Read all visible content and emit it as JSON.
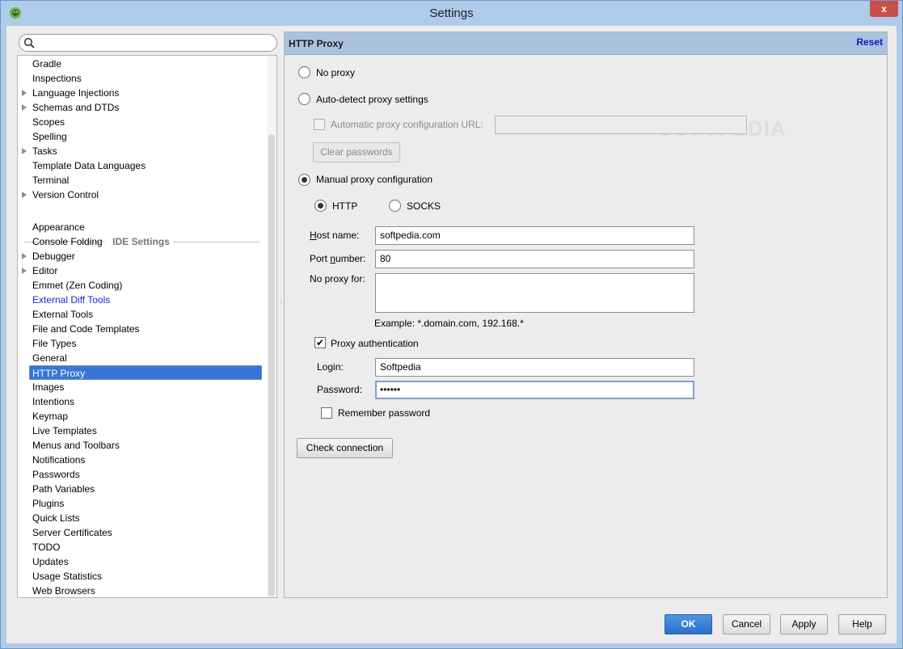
{
  "window": {
    "title": "Settings",
    "close_glyph": "x"
  },
  "search": {
    "value": "",
    "icon": "search-icon"
  },
  "tree": {
    "items_top": [
      {
        "label": "Gradle",
        "expandable": false
      },
      {
        "label": "Inspections",
        "expandable": false
      },
      {
        "label": "Language Injections",
        "expandable": true
      },
      {
        "label": "Schemas and DTDs",
        "expandable": true
      },
      {
        "label": "Scopes",
        "expandable": false
      },
      {
        "label": "Spelling",
        "expandable": false
      },
      {
        "label": "Tasks",
        "expandable": true
      },
      {
        "label": "Template Data Languages",
        "expandable": false
      },
      {
        "label": "Terminal",
        "expandable": false
      },
      {
        "label": "Version Control",
        "expandable": true
      }
    ],
    "section_label": "IDE Settings",
    "items_ide": [
      {
        "label": "Appearance",
        "expandable": false
      },
      {
        "label": "Console Folding",
        "expandable": false
      },
      {
        "label": "Debugger",
        "expandable": true
      },
      {
        "label": "Editor",
        "expandable": true
      },
      {
        "label": "Emmet (Zen Coding)",
        "expandable": false
      },
      {
        "label": "External Diff Tools",
        "expandable": false,
        "link": true
      },
      {
        "label": "External Tools",
        "expandable": false
      },
      {
        "label": "File and Code Templates",
        "expandable": false
      },
      {
        "label": "File Types",
        "expandable": false
      },
      {
        "label": "General",
        "expandable": false
      },
      {
        "label": "HTTP Proxy",
        "expandable": false,
        "selected": true
      },
      {
        "label": "Images",
        "expandable": false
      },
      {
        "label": "Intentions",
        "expandable": false
      },
      {
        "label": "Keymap",
        "expandable": false
      },
      {
        "label": "Live Templates",
        "expandable": false
      },
      {
        "label": "Menus and Toolbars",
        "expandable": false
      },
      {
        "label": "Notifications",
        "expandable": false
      },
      {
        "label": "Passwords",
        "expandable": false
      },
      {
        "label": "Path Variables",
        "expandable": false
      },
      {
        "label": "Plugins",
        "expandable": false
      },
      {
        "label": "Quick Lists",
        "expandable": false
      },
      {
        "label": "Server Certificates",
        "expandable": false
      },
      {
        "label": "TODO",
        "expandable": false
      },
      {
        "label": "Updates",
        "expandable": false
      },
      {
        "label": "Usage Statistics",
        "expandable": false
      },
      {
        "label": "Web Browsers",
        "expandable": false
      }
    ]
  },
  "panel": {
    "title": "HTTP Proxy",
    "reset": "Reset",
    "no_proxy": "No proxy",
    "auto_detect": "Auto-detect proxy settings",
    "auto_config_url_label": "Automatic proxy configuration URL:",
    "auto_config_url_value": "",
    "clear_passwords": "Clear passwords",
    "manual": "Manual proxy configuration",
    "http": "HTTP",
    "socks": "SOCKS",
    "host_label": "Host name:",
    "host_value": "softpedia.com",
    "port_label": "Port number:",
    "port_value": "80",
    "no_proxy_for_label": "No proxy for:",
    "no_proxy_for_value": "",
    "example": "Example: *.domain.com, 192.168.*",
    "proxy_auth": "Proxy authentication",
    "login_label": "Login:",
    "login_value": "Softpedia",
    "password_label": "Password:",
    "password_value": "••••••",
    "remember_password": "Remember password",
    "check_connection": "Check connection",
    "watermark": "SOFTPEDIA"
  },
  "footer": {
    "ok": "OK",
    "cancel": "Cancel",
    "apply": "Apply",
    "help": "Help"
  },
  "colors": {
    "selection": "#3875d7",
    "header_bg": "#a9c2e0",
    "link": "#2121d6",
    "primary_button": "#2a6fcb"
  }
}
